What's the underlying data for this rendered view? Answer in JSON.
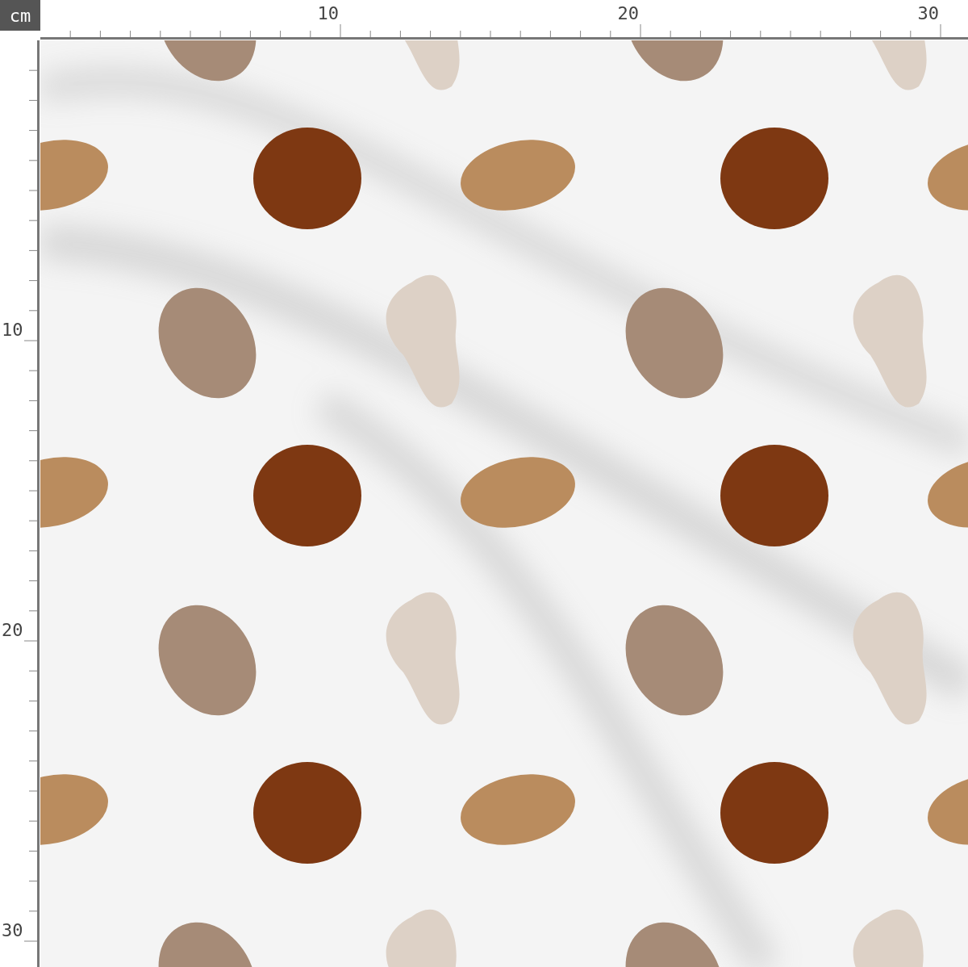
{
  "unit": "cm",
  "top_ruler": {
    "labels": [
      "10",
      "20",
      "30"
    ]
  },
  "left_ruler": {
    "labels": [
      "10",
      "20",
      "30"
    ]
  }
}
